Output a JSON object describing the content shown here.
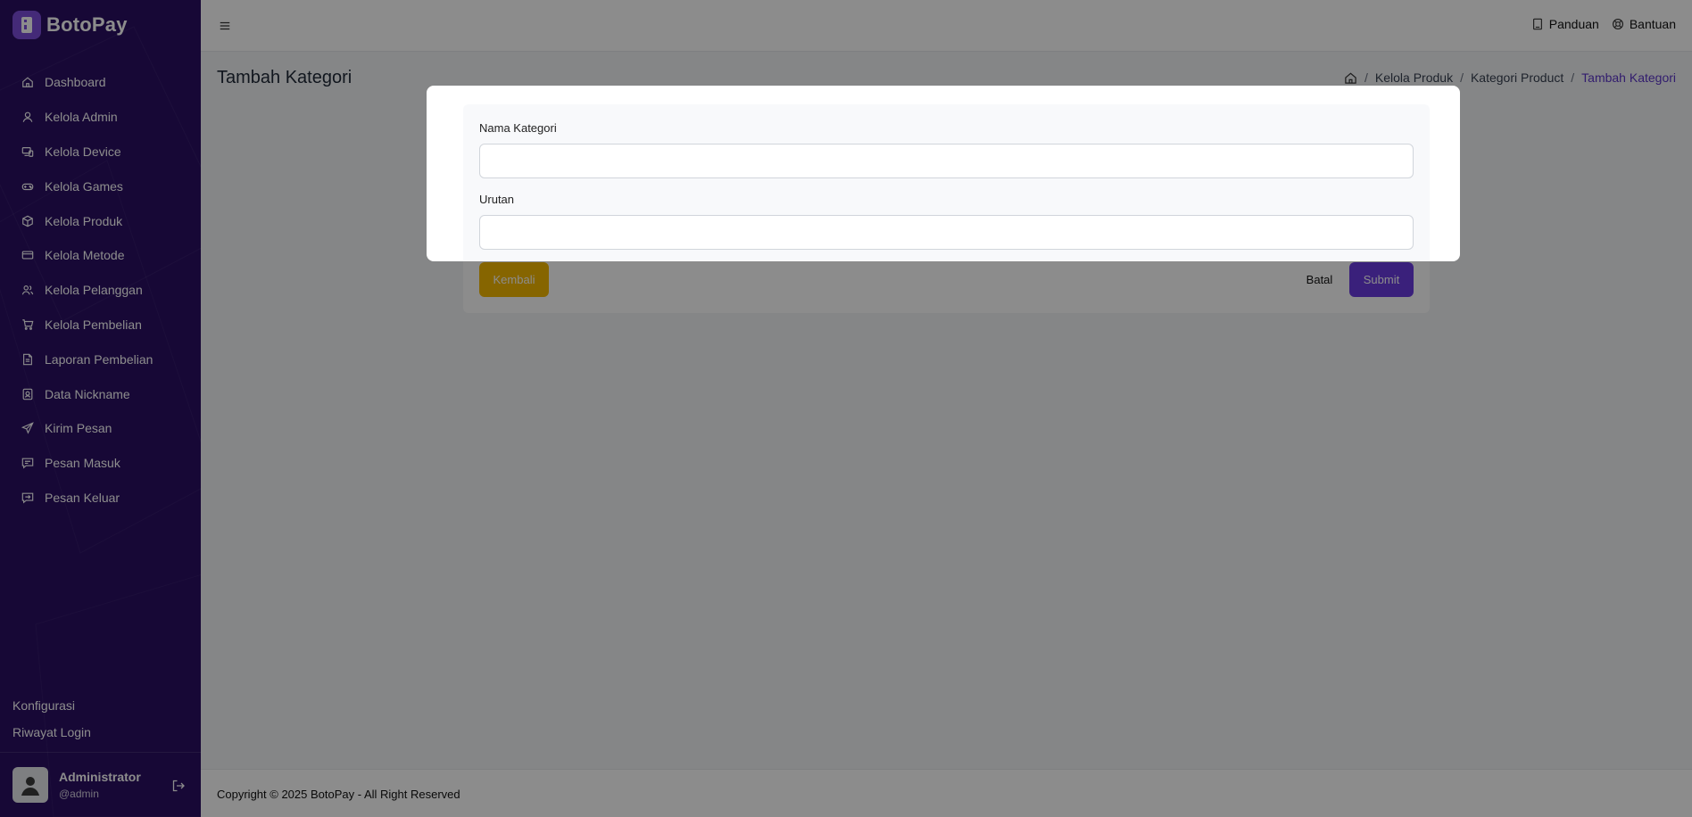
{
  "brand": {
    "name": "BotoPay"
  },
  "sidebar": {
    "items": [
      {
        "label": "Dashboard",
        "icon": "home-icon"
      },
      {
        "label": "Kelola Admin",
        "icon": "user-icon"
      },
      {
        "label": "Kelola Device",
        "icon": "devices-icon"
      },
      {
        "label": "Kelola Games",
        "icon": "gamepad-icon"
      },
      {
        "label": "Kelola Produk",
        "icon": "box-icon"
      },
      {
        "label": "Kelola Metode",
        "icon": "credit-card-icon"
      },
      {
        "label": "Kelola Pelanggan",
        "icon": "users-icon"
      },
      {
        "label": "Kelola Pembelian",
        "icon": "cart-icon"
      },
      {
        "label": "Laporan Pembelian",
        "icon": "report-icon"
      },
      {
        "label": "Data Nickname",
        "icon": "database-icon"
      },
      {
        "label": "Kirim Pesan",
        "icon": "send-icon"
      },
      {
        "label": "Pesan Masuk",
        "icon": "message-in-icon"
      },
      {
        "label": "Pesan Keluar",
        "icon": "message-out-icon"
      }
    ],
    "bottom_links": [
      "Konfigurasi",
      "Riwayat Login"
    ],
    "user": {
      "name": "Administrator",
      "handle": "@admin"
    }
  },
  "topbar": {
    "links": [
      "Panduan",
      "Bantuan"
    ]
  },
  "page": {
    "title": "Tambah Kategori",
    "breadcrumb": [
      "Kelola Produk",
      "Kategori Product",
      "Tambah Kategori"
    ]
  },
  "form": {
    "fields": [
      {
        "label": "Nama Kategori",
        "value": ""
      },
      {
        "label": "Urutan",
        "value": ""
      }
    ],
    "buttons": {
      "back": "Kembali",
      "cancel": "Batal",
      "submit": "Submit"
    }
  },
  "footer": {
    "text": "Copyright © 2025 BotoPay - All Right Reserved"
  },
  "colors": {
    "sidebar_bg": "#2a0f63",
    "accent": "#6a3be0",
    "warning": "#f5b800"
  }
}
